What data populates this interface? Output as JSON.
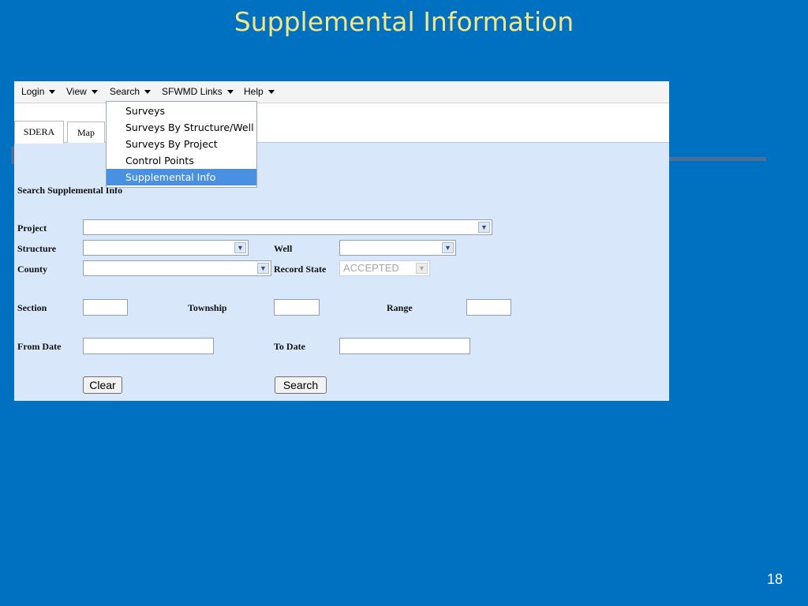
{
  "slide": {
    "title": "Supplemental Information",
    "page_number": "18"
  },
  "menubar": {
    "items": [
      {
        "label": "Login"
      },
      {
        "label": "View"
      },
      {
        "label": "Search"
      },
      {
        "label": "SFWMD Links"
      },
      {
        "label": "Help"
      }
    ]
  },
  "search_menu": {
    "items": [
      {
        "label": "Surveys"
      },
      {
        "label": "Surveys By Structure/Well"
      },
      {
        "label": "Surveys By Project"
      },
      {
        "label": "Control Points"
      },
      {
        "label": "Supplemental Info"
      }
    ],
    "selected": "Supplemental Info"
  },
  "tabs": [
    {
      "label": "SDERA"
    },
    {
      "label": "Map"
    }
  ],
  "form": {
    "heading": "Search Supplemental Info",
    "project_label": "Project",
    "structure_label": "Structure",
    "well_label": "Well",
    "county_label": "County",
    "record_state_label": "Record State",
    "record_state_value": "ACCEPTED",
    "section_label": "Section",
    "township_label": "Township",
    "range_label": "Range",
    "from_date_label": "From Date",
    "to_date_label": "To Date",
    "clear_label": "Clear",
    "search_label": "Search"
  },
  "colors": {
    "slide_background": "#0070c0",
    "title": "#f2e68a",
    "form_background": "#d9e7fb",
    "menu_highlight": "#4a90e2"
  }
}
